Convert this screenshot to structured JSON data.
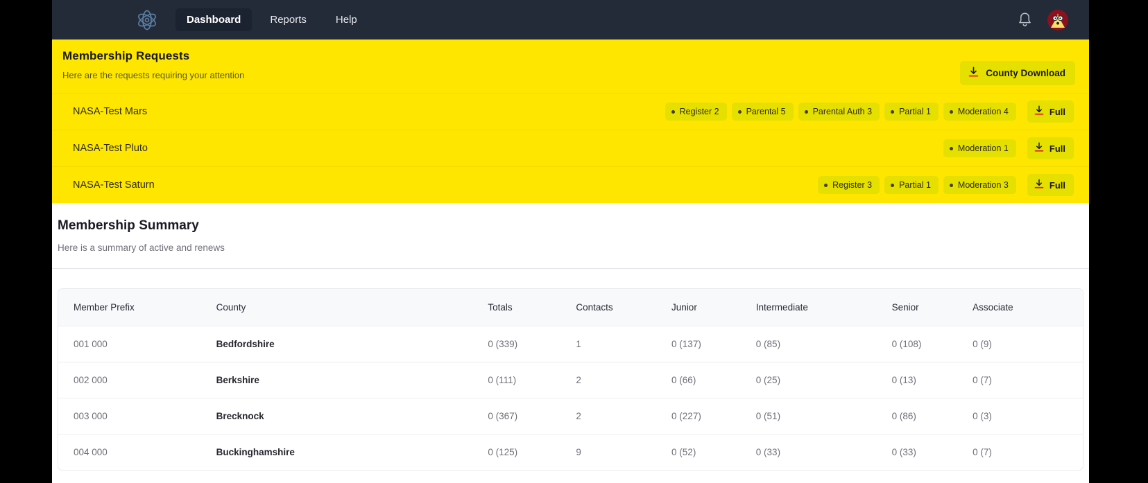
{
  "navbar": {
    "brand_icon": "atom-logo-icon",
    "items": [
      {
        "label": "Dashboard",
        "active": true
      },
      {
        "label": "Reports",
        "active": false
      },
      {
        "label": "Help",
        "active": false
      }
    ],
    "notifications_icon": "bell-icon",
    "avatar_icon": "user-avatar-chicken",
    "background": "#232b38",
    "active_background": "#1b2330"
  },
  "requests": {
    "title": "Membership Requests",
    "subtitle": "Here are the requests requiring your attention",
    "county_download_label": "County Download",
    "download_icon": "download-icon",
    "background": "#ffe600",
    "badge_background": "#e6e000",
    "rows": [
      {
        "name": "NASA-Test Mars",
        "badges": [
          "Register 2",
          "Parental 5",
          "Parental Auth 3",
          "Partial 1",
          "Moderation 4"
        ],
        "full_label": "Full"
      },
      {
        "name": "NASA-Test Pluto",
        "badges": [
          "Moderation 1"
        ],
        "full_label": "Full"
      },
      {
        "name": "NASA-Test Saturn",
        "badges": [
          "Register 3",
          "Partial 1",
          "Moderation 3"
        ],
        "full_label": "Full"
      }
    ]
  },
  "summary": {
    "title": "Membership Summary",
    "subtitle": "Here is a summary of active and renews",
    "table": {
      "columns": [
        "Member Prefix",
        "County",
        "Totals",
        "Contacts",
        "Junior",
        "Intermediate",
        "Senior",
        "Associate"
      ],
      "rows": [
        {
          "prefix": "001 000",
          "county": "Bedfordshire",
          "totals": "0 (339)",
          "contacts": "1",
          "junior": "0 (137)",
          "intermediate": "0 (85)",
          "senior": "0 (108)",
          "associate": "0 (9)"
        },
        {
          "prefix": "002 000",
          "county": "Berkshire",
          "totals": "0 (111)",
          "contacts": "2",
          "junior": "0 (66)",
          "intermediate": "0 (25)",
          "senior": "0 (13)",
          "associate": "0 (7)"
        },
        {
          "prefix": "003 000",
          "county": "Brecknock",
          "totals": "0 (367)",
          "contacts": "2",
          "junior": "0 (227)",
          "intermediate": "0 (51)",
          "senior": "0 (86)",
          "associate": "0 (3)"
        },
        {
          "prefix": "004 000",
          "county": "Buckinghamshire",
          "totals": "0 (125)",
          "contacts": "9",
          "junior": "0 (52)",
          "intermediate": "0 (33)",
          "senior": "0 (33)",
          "associate": "0 (7)"
        }
      ]
    }
  }
}
